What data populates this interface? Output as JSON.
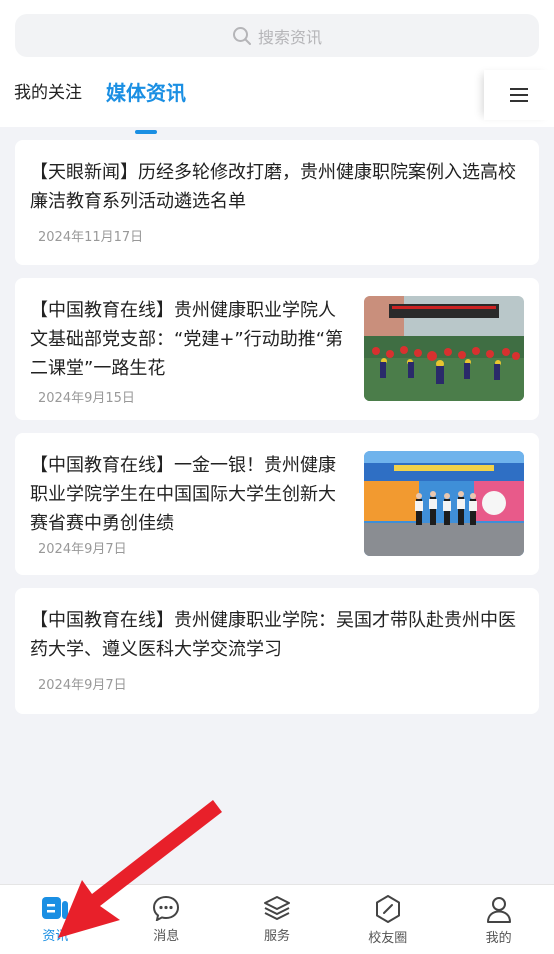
{
  "search": {
    "placeholder": "搜索资讯"
  },
  "tabs": [
    {
      "label": "我的关注",
      "active": false
    },
    {
      "label": "媒体资讯",
      "active": true
    }
  ],
  "feed": [
    {
      "title": "【天眼新闻】历经多轮修改打磨，贵州健康职院案例入选高校廉洁教育系列活动遴选名单",
      "date": "2024年11月17日",
      "has_thumb": false
    },
    {
      "title": "【中国教育在线】贵州健康职业学院人文基础部党支部：“党建+”行动助推“第二课堂”一路生花",
      "date": "2024年9月15日",
      "has_thumb": true
    },
    {
      "title": "【中国教育在线】一金一银！贵州健康职业学院学生在中国国际大学生创新大赛省赛中勇创佳绩",
      "date": "2024年9月7日",
      "has_thumb": true
    },
    {
      "title": "【中国教育在线】贵州健康职业学院：吴国才带队赴贵州中医药大学、遵义医科大学交流学习",
      "date": "2024年9月7日",
      "has_thumb": false
    }
  ],
  "tabbar": [
    {
      "label": "资讯",
      "icon": "news-icon",
      "active": true
    },
    {
      "label": "消息",
      "icon": "chat-icon",
      "active": false
    },
    {
      "label": "服务",
      "icon": "layers-icon",
      "active": false
    },
    {
      "label": "校友圈",
      "icon": "compass-icon",
      "active": false
    },
    {
      "label": "我的",
      "icon": "user-icon",
      "active": false
    }
  ],
  "colors": {
    "accent": "#1a8fe3",
    "annotation": "#e8202a"
  }
}
